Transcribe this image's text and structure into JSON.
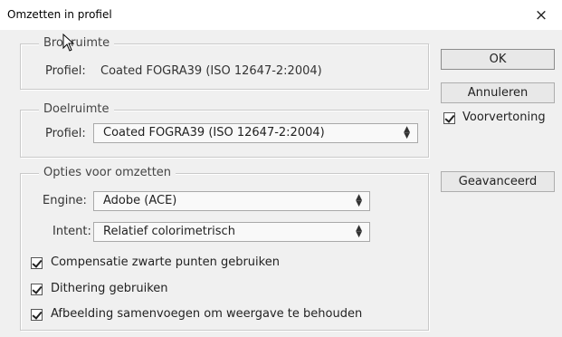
{
  "dialog": {
    "title": "Omzetten in profiel",
    "close_glyph": "×"
  },
  "source": {
    "legend": "Bronruimte",
    "profile_label": "Profiel:",
    "profile_value": "Coated FOGRA39 (ISO 12647-2:2004)"
  },
  "destination": {
    "legend": "Doelruimte",
    "profile_label": "Profiel:",
    "profile_value": "Coated FOGRA39 (ISO 12647-2:2004)"
  },
  "options": {
    "legend": "Opties voor omzetten",
    "engine_label": "Engine:",
    "engine_value": "Adobe (ACE)",
    "intent_label": "Intent:",
    "intent_value": "Relatief colorimetrisch",
    "checkboxes": [
      {
        "label": "Compensatie zwarte punten gebruiken",
        "checked": true
      },
      {
        "label": "Dithering gebruiken",
        "checked": true
      },
      {
        "label": "Afbeelding samenvoegen om weergave te behouden",
        "checked": true
      }
    ]
  },
  "buttons": {
    "ok": "OK",
    "cancel": "Annuleren",
    "advanced": "Geavanceerd"
  },
  "preview": {
    "label": "Voorvertoning",
    "checked": true
  },
  "icons": {
    "cursor": "mouse-pointer-icon",
    "close": "close-icon",
    "check": "checkmark-icon",
    "dropdown": "updown-arrow-icon"
  }
}
